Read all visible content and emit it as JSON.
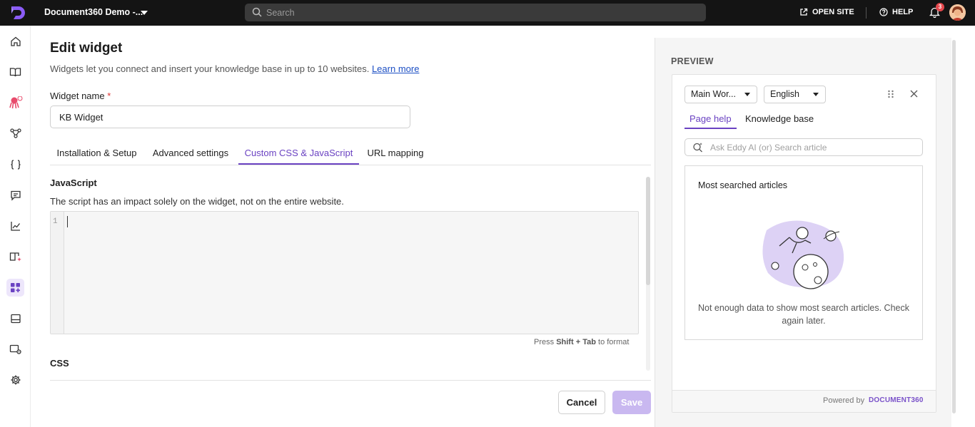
{
  "topbar": {
    "project_name": "Document360 Demo -...",
    "search_placeholder": "Search",
    "open_site_label": "OPEN SITE",
    "help_label": "HELP",
    "notification_count": "3"
  },
  "page": {
    "title": "Edit widget",
    "subtitle": "Widgets let you connect and insert your knowledge base in up to 10 websites.",
    "learn_more": "Learn more"
  },
  "form": {
    "widget_name_label": "Widget name",
    "required_mark": "*",
    "widget_name_value": "KB Widget"
  },
  "tabs": [
    {
      "label": "Installation & Setup"
    },
    {
      "label": "Advanced settings"
    },
    {
      "label": "Custom CSS & JavaScript"
    },
    {
      "label": "URL mapping"
    }
  ],
  "active_tab": "Custom CSS & JavaScript",
  "javascript": {
    "title": "JavaScript",
    "description": "The script has an impact solely on the widget, not on the entire website.",
    "line_number": "1"
  },
  "format_hint": {
    "prefix": "Press",
    "key1": "Shift",
    "plus": "+",
    "key2": "Tab",
    "suffix": "to format"
  },
  "css": {
    "title": "CSS"
  },
  "actions": {
    "cancel": "Cancel",
    "save": "Save"
  },
  "preview": {
    "title": "PREVIEW",
    "workspace_select": "Main Wor...",
    "language_select": "English",
    "tabs": [
      "Page help",
      "Knowledge base"
    ],
    "search_placeholder": "Ask Eddy AI (or) Search article",
    "most_searched_title": "Most searched articles",
    "empty_message": "Not enough data to show most search articles. Check again later.",
    "powered_by": "Powered by",
    "brand": "DOCUMENT360"
  },
  "colors": {
    "accent": "#6a42c2",
    "topbar": "#141414",
    "save_disabled": "#c9b8f0"
  }
}
